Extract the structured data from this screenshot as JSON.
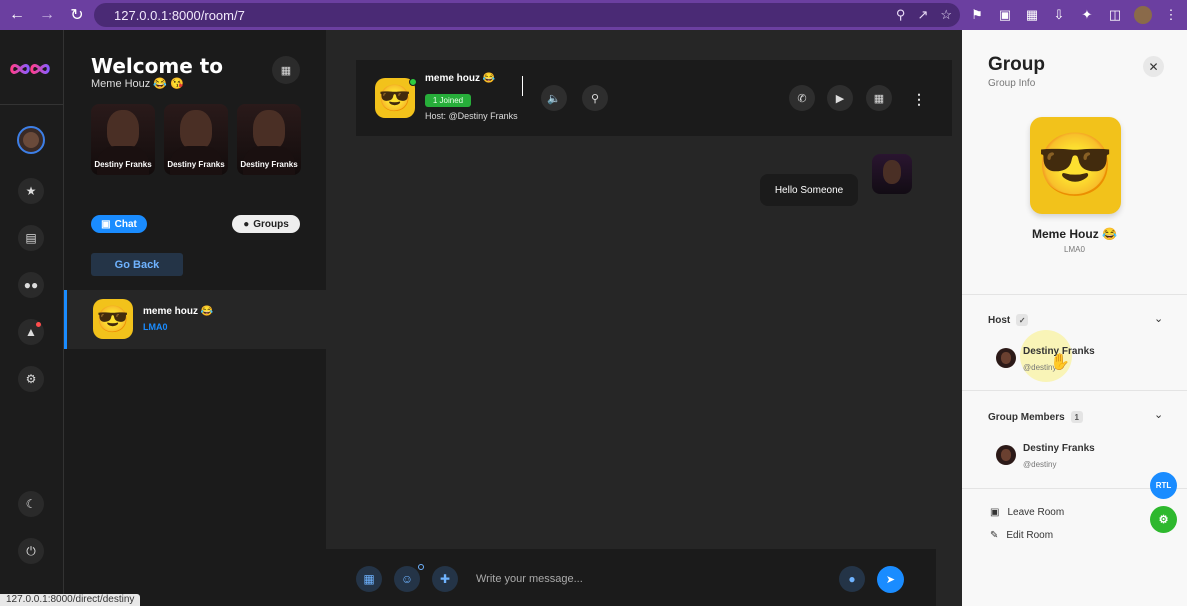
{
  "browser": {
    "url": "127.0.0.1:8000/room/7",
    "status_url": "127.0.0.1:8000/direct/destiny"
  },
  "colors": {
    "accent": "#1a8cff",
    "browser_frame": "#6b3fa0",
    "joined_badge": "#27ae3a",
    "panel_dark": "#1b1b1b",
    "info_panel": "#f8f8f8"
  },
  "rail": {
    "icons": [
      "star-icon",
      "document-icon",
      "group-icon",
      "bell-icon",
      "gear-icon",
      "moon-icon",
      "power-icon"
    ]
  },
  "side": {
    "title": "Welcome to",
    "subtitle": "Meme Houz 😂 😘",
    "stories": [
      {
        "name": "Destiny Franks"
      },
      {
        "name": "Destiny Franks"
      },
      {
        "name": "Destiny Franks"
      }
    ],
    "chat_label": "Chat",
    "groups_label": "Groups",
    "go_back_label": "Go Back",
    "room": {
      "name": "meme houz 😂",
      "sub": "LMA0"
    }
  },
  "chat": {
    "header": {
      "name": "meme houz 😂",
      "joined": "1 Joined",
      "host": "Host: @Destiny Franks"
    },
    "messages": [
      {
        "text": "Hello Someone"
      }
    ],
    "input_placeholder": "Write your message..."
  },
  "info": {
    "title": "Group",
    "subtitle": "Group Info",
    "group_name": "Meme Houz 😂",
    "group_desc": "LMA0",
    "host_label": "Host",
    "host": {
      "name": "Destiny Franks",
      "handle": "@destiny"
    },
    "members_label": "Group Members",
    "members_count": "1",
    "members": [
      {
        "name": "Destiny Franks",
        "handle": "@destiny"
      }
    ],
    "leave_label": "Leave Room",
    "edit_label": "Edit Room",
    "rtl_label": "RTL"
  }
}
